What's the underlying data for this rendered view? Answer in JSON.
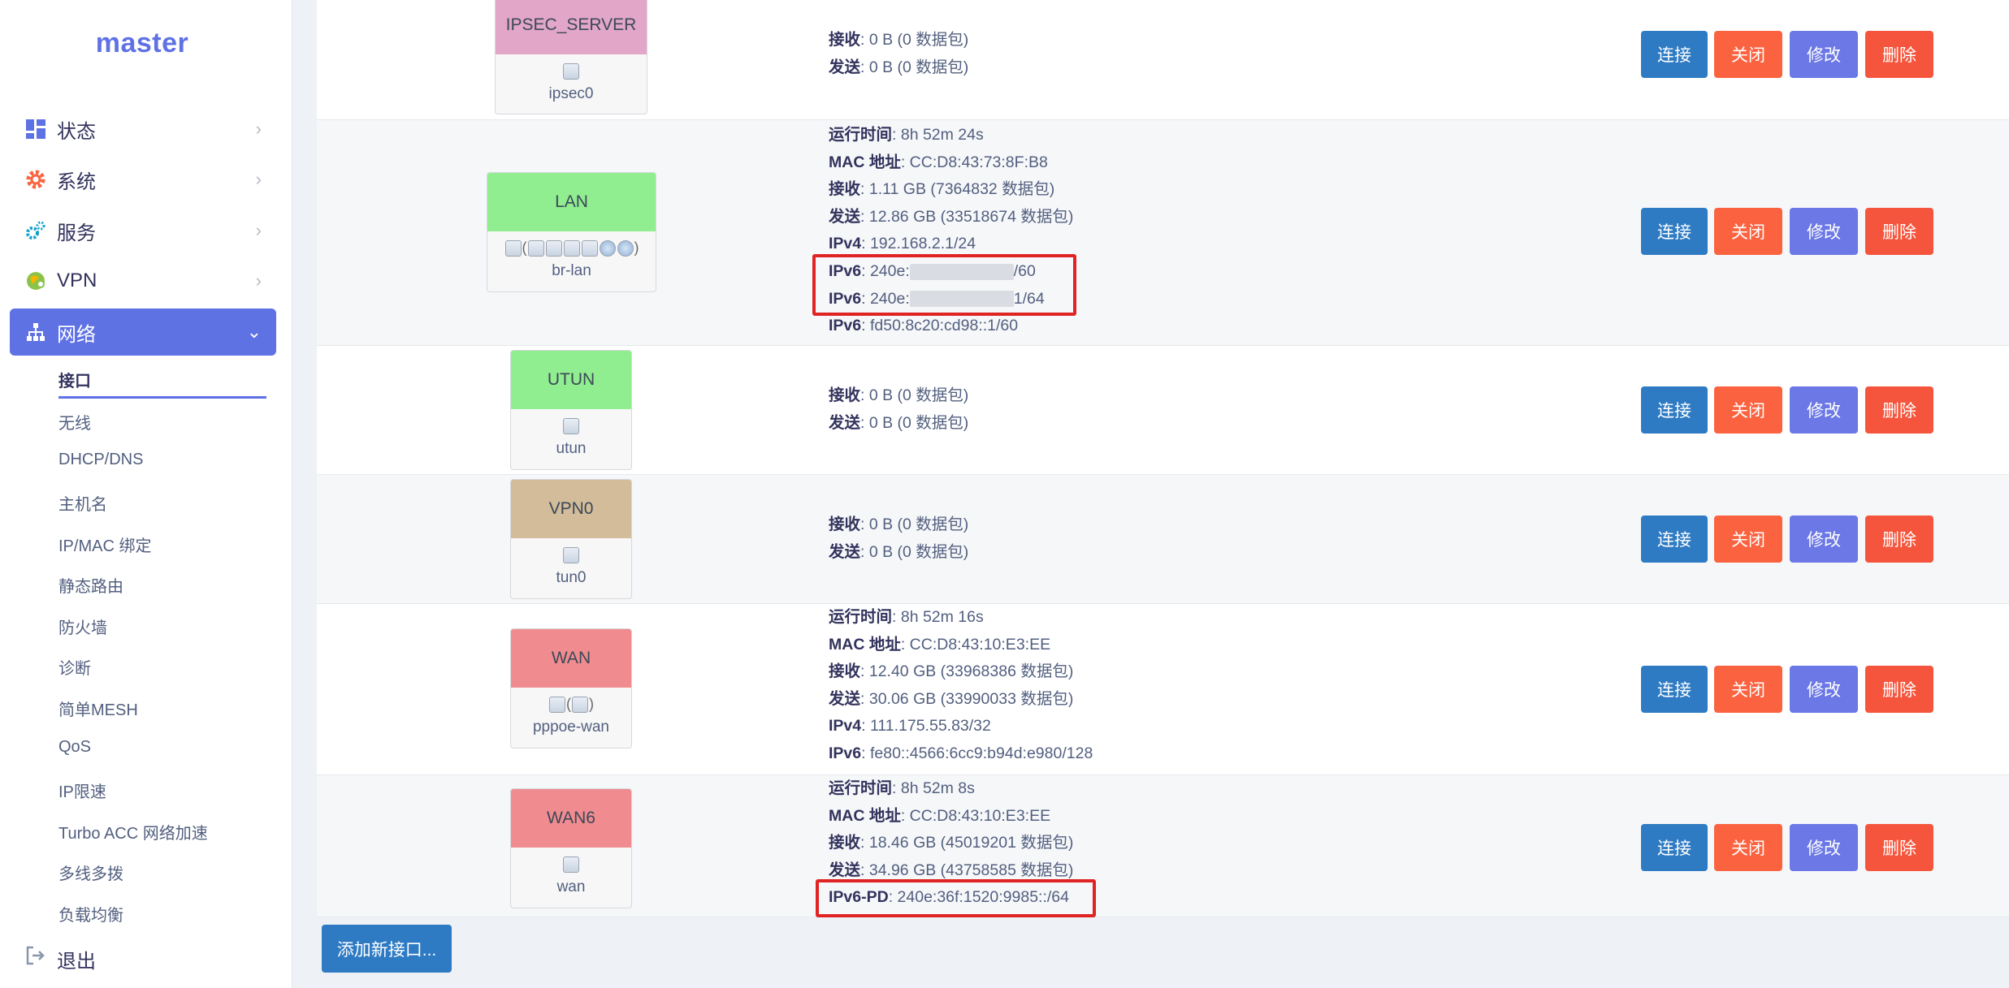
{
  "sidebar": {
    "logo": "master",
    "items": [
      {
        "label": "状态"
      },
      {
        "label": "系统"
      },
      {
        "label": "服务"
      },
      {
        "label": "VPN"
      },
      {
        "label": "网络"
      }
    ],
    "subitems": [
      {
        "label": "接口"
      },
      {
        "label": "无线"
      },
      {
        "label": "DHCP/DNS"
      },
      {
        "label": "主机名"
      },
      {
        "label": "IP/MAC 绑定"
      },
      {
        "label": "静态路由"
      },
      {
        "label": "防火墙"
      },
      {
        "label": "诊断"
      },
      {
        "label": "简单MESH"
      },
      {
        "label": "QoS"
      },
      {
        "label": "IP限速"
      },
      {
        "label": "Turbo ACC 网络加速"
      },
      {
        "label": "多线多拨"
      },
      {
        "label": "负载均衡"
      }
    ],
    "logout": "退出"
  },
  "colors": {
    "ipsec_server": "#e2a6c9",
    "lan": "#90ee90",
    "utun": "#90ee90",
    "vpn0": "#d2bc9a",
    "wan": "#f08c8f",
    "wan6": "#f08c8f",
    "connect": "#2e7bc4",
    "close": "#fb6340",
    "edit": "#6b78e6",
    "delete": "#f5553c",
    "accent": "#5e72e4"
  },
  "buttons": {
    "connect": "连接",
    "close": "关闭",
    "edit": "修改",
    "delete": "删除",
    "add": "添加新接口..."
  },
  "interfaces": [
    {
      "name": "IPSEC_SERVER",
      "device": "ipsec0",
      "lines": [
        {
          "k": "接收",
          "v": ": 0 B (0 数据包)"
        },
        {
          "k": "发送",
          "v": ": 0 B (0 数据包)"
        }
      ]
    },
    {
      "name": "LAN",
      "device": "br-lan",
      "lines": [
        {
          "k": "运行时间",
          "v": ": 8h 52m 24s"
        },
        {
          "k": "MAC 地址",
          "v": ": CC:D8:43:73:8F:B8"
        },
        {
          "k": "接收",
          "v": ": 1.11 GB (7364832 数据包)"
        },
        {
          "k": "发送",
          "v": ": 12.86 GB (33518674 数据包)"
        },
        {
          "k": "IPv4",
          "v": ": 192.168.2.1/24"
        },
        {
          "k": "IPv6",
          "v_pre": ": 240e:",
          "v_post": "/60"
        },
        {
          "k": "IPv6",
          "v_pre": ": 240e:",
          "v_post": "1/64"
        },
        {
          "k": "IPv6",
          "v": ": fd50:8c20:cd98::1/60"
        }
      ]
    },
    {
      "name": "UTUN",
      "device": "utun",
      "lines": [
        {
          "k": "接收",
          "v": ": 0 B (0 数据包)"
        },
        {
          "k": "发送",
          "v": ": 0 B (0 数据包)"
        }
      ]
    },
    {
      "name": "VPN0",
      "device": "tun0",
      "lines": [
        {
          "k": "接收",
          "v": ": 0 B (0 数据包)"
        },
        {
          "k": "发送",
          "v": ": 0 B (0 数据包)"
        }
      ]
    },
    {
      "name": "WAN",
      "device": "pppoe-wan",
      "lines": [
        {
          "k": "运行时间",
          "v": ": 8h 52m 16s"
        },
        {
          "k": "MAC 地址",
          "v": ": CC:D8:43:10:E3:EE"
        },
        {
          "k": "接收",
          "v": ": 12.40 GB (33968386 数据包)"
        },
        {
          "k": "发送",
          "v": ": 30.06 GB (33990033 数据包)"
        },
        {
          "k": "IPv4",
          "v": ": 111.175.55.83/32"
        },
        {
          "k": "IPv6",
          "v": ": fe80::4566:6cc9:b94d:e980/128"
        }
      ]
    },
    {
      "name": "WAN6",
      "device": "wan",
      "lines": [
        {
          "k": "运行时间",
          "v": ": 8h 52m 8s"
        },
        {
          "k": "MAC 地址",
          "v": ": CC:D8:43:10:E3:EE"
        },
        {
          "k": "接收",
          "v": ": 18.46 GB (45019201 数据包)"
        },
        {
          "k": "发送",
          "v": ": 34.96 GB (43758585 数据包)"
        },
        {
          "k": "IPv6-PD",
          "v": ": 240e:36f:1520:9985::/64"
        }
      ]
    }
  ]
}
